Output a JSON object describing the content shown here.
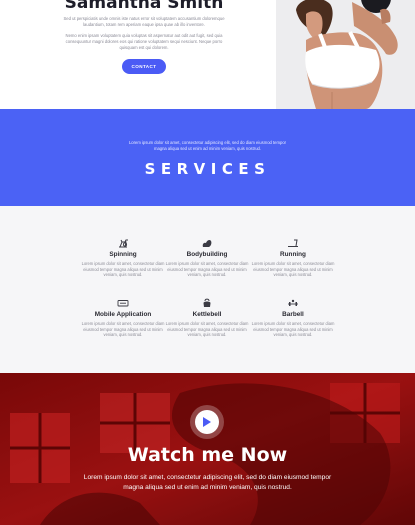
{
  "hero": {
    "name": "Samantha Smith",
    "paragraph_1": "Sed ut perspiciatis unde omnis iste natus error sit voluptatem accusantium doloremque laudantium, totam rem aperiam eaque ipsa quae ab illo inventore.",
    "paragraph_2": "Nemo enim ipsam voluptatem quia voluptas sit aspernatur aut odit aut fugit, sed quia consequuntur magni dolores eos qui ratione voluptatem sequi nesciunt. Neque porro quisquam est qui dolorem.",
    "contact_label": "CONTACT"
  },
  "services_banner": {
    "text": "Lorem ipsum dolor sit amet, consectetur adipiscing elit, sed do diam eiusmod tempor magna aliqua sed ut enim ad minim veniam, quis nostrud.",
    "title": "SERVICES"
  },
  "services": [
    {
      "title": "Spinning",
      "icon": "spinning-bike-icon",
      "desc": "Lorem ipsum dolor sit amet, consectetur diam eiusmod tempor magna aliqua sed ut minim veniam, quis nostrud."
    },
    {
      "title": "Bodybuilding",
      "icon": "flexed-arm-icon",
      "desc": "Lorem ipsum dolor sit amet, consectetur diam eiusmod tempor magna aliqua sed ut minim veniam, quis nostrud."
    },
    {
      "title": "Running",
      "icon": "treadmill-icon",
      "desc": "Lorem ipsum dolor sit amet, consectetur diam eiusmod tempor magna aliqua sed ut minim veniam, quis nostrud."
    },
    {
      "title": "Mobile Application",
      "icon": "mobile-app-icon",
      "desc": "Lorem ipsum dolor sit amet, consectetur diam eiusmod tempor magna aliqua sed ut minim veniam, quis nostrud."
    },
    {
      "title": "Kettlebell",
      "icon": "kettlebell-icon",
      "desc": "Lorem ipsum dolor sit amet, consectetur diam eiusmod tempor magna aliqua sed ut minim veniam, quis nostrud."
    },
    {
      "title": "Barbell",
      "icon": "barbell-icon",
      "desc": "Lorem ipsum dolor sit amet, consectetur diam eiusmod tempor magna aliqua sed ut minim veniam, quis nostrud."
    }
  ],
  "video": {
    "title": "Watch me Now",
    "text": "Lorem ipsum dolor sit amet, consectetur adipiscing elit, sed do diam eiusmod tempor magna aliqua sed ut enim ad minim veniam, quis nostrud."
  },
  "colors": {
    "accent": "#4b62f5",
    "button": "#4b5bf5",
    "video_red": "#9b0e0e",
    "section_bg": "#f6f6f8"
  }
}
